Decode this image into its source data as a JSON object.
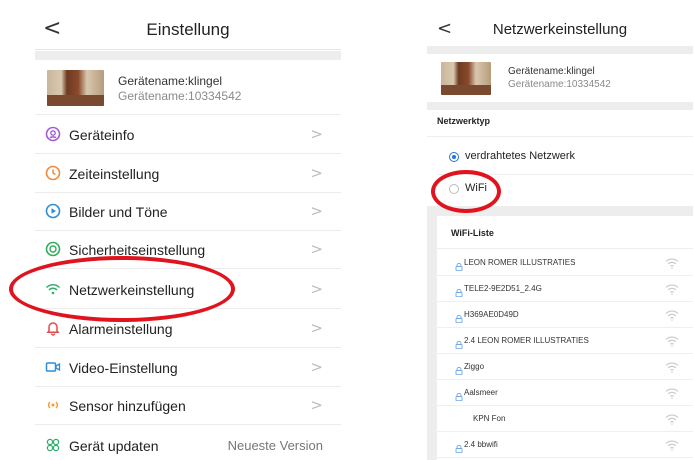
{
  "left": {
    "title": "Einstellung",
    "back_glyph": "<",
    "device": {
      "name": "Gerätename:klingel",
      "id": "Gerätename:10334542"
    },
    "menu": [
      {
        "icon": "info-circle-icon",
        "color": "#a35bd6",
        "label": "Geräteinfo"
      },
      {
        "icon": "clock-icon",
        "color": "#f08a3a",
        "label": "Zeiteinstellung"
      },
      {
        "icon": "play-circle-icon",
        "color": "#2a8fd8",
        "label": "Bilder und Töne"
      },
      {
        "icon": "security-icon",
        "color": "#2fae5b",
        "label": "Sicherheitseinstellung"
      },
      {
        "icon": "wifi-icon",
        "color": "#2fae6b",
        "label": "Netzwerkeinstellung"
      },
      {
        "icon": "bell-icon",
        "color": "#e24a4a",
        "label": "Alarmeinstellung"
      },
      {
        "icon": "video-icon",
        "color": "#2a8fd8",
        "label": "Video-Einstellung"
      },
      {
        "icon": "sensor-icon",
        "color": "#f0a030",
        "label": "Sensor hinzufügen"
      },
      {
        "icon": "update-icon",
        "color": "#2fae6b",
        "label": "Gerät updaten",
        "value": "Neueste Version"
      }
    ],
    "chevron": ">"
  },
  "right": {
    "title": "Netzwerkeinstellung",
    "back_glyph": "<",
    "device": {
      "name": "Gerätename:klingel",
      "id": "Gerätename:10334542"
    },
    "network_type_label": "Netzwerktyp",
    "options": [
      {
        "label": "verdrahtetes Netzwerk",
        "selected": true
      },
      {
        "label": "WiFi",
        "selected": false
      }
    ],
    "wifi_list_label": "WiFi-Liste",
    "wifi_list": [
      {
        "ssid": "LEON ROMER ILLUSTRATIES",
        "locked": true
      },
      {
        "ssid": "TELE2-9E2D51_2.4G",
        "locked": true
      },
      {
        "ssid": "H369AE0D49D",
        "locked": true
      },
      {
        "ssid": "2.4 LEON ROMER ILLUSTRATIES",
        "locked": true
      },
      {
        "ssid": "Ziggo",
        "locked": true
      },
      {
        "ssid": "Aalsmeer",
        "locked": true
      },
      {
        "ssid": "KPN Fon",
        "locked": false
      },
      {
        "ssid": "2.4 bbwifi",
        "locked": true
      }
    ]
  },
  "colors": {
    "annotation": "#e0141e",
    "accent": "#2a72d8",
    "lock": "#6fa8e8"
  }
}
